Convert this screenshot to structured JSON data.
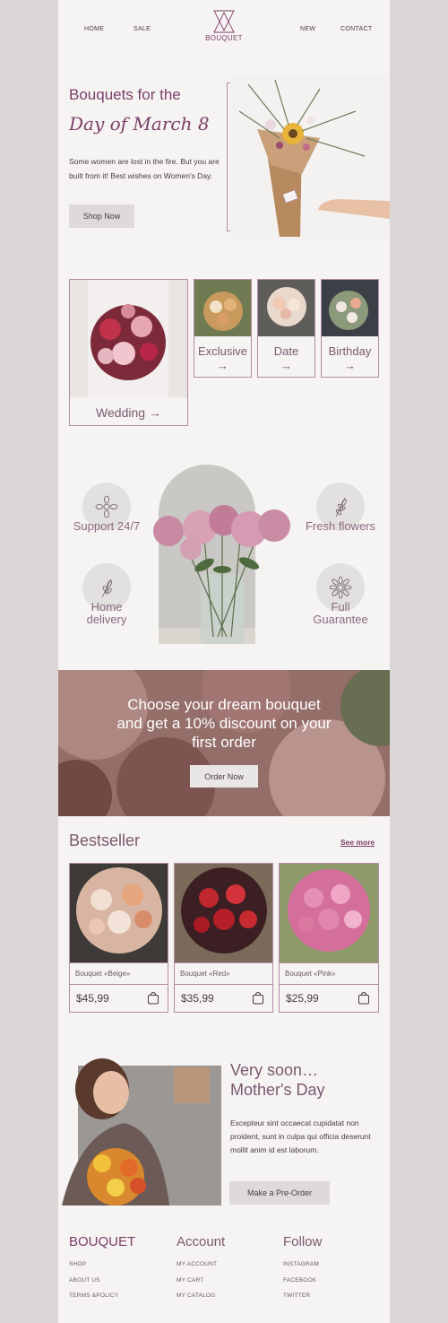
{
  "nav": {
    "home": "HOME",
    "sale": "SALE",
    "logo": "BOUQUET",
    "new": "NEW",
    "contact": "CONTACT"
  },
  "hero": {
    "title_line1": "Bouquets for the",
    "title_line2": "Day of March 8",
    "text": "Some women are lost in the fire. But you are built from it! Best wishes on Women's Day.",
    "button": "Shop Now"
  },
  "categories": [
    {
      "label": "Wedding →"
    },
    {
      "label": "Exclusive",
      "arrow": "→"
    },
    {
      "label": "Date",
      "arrow": "→"
    },
    {
      "label": "Birthday",
      "arrow": "→"
    }
  ],
  "features": [
    {
      "label": "Support 24/7",
      "icon": "flower-icon"
    },
    {
      "label": "Home delivery",
      "icon": "branch-icon"
    },
    {
      "label": "Fresh flowers",
      "icon": "sprig-icon"
    },
    {
      "label": "Full Guarantee",
      "icon": "daisy-icon"
    }
  ],
  "promo": {
    "text_line1": "Choose your dream bouquet",
    "text_line2": "and get a 10% discount on your",
    "text_line3": "first order",
    "button": "Order Now"
  },
  "bestseller": {
    "title": "Bestseller",
    "see_more": "See more",
    "products": [
      {
        "name": "Bouquet «Beige»",
        "price": "$45,99",
        "icon": "bag-icon"
      },
      {
        "name": "Bouquet «Red»",
        "price": "$35,99",
        "icon": "bag-icon"
      },
      {
        "name": "Bouquet «Pink»",
        "price": "$25,99",
        "icon": "bag-icon"
      }
    ]
  },
  "mothers": {
    "title_line1": "Very soon…",
    "title_line2": "Mother's Day",
    "text": "Excepteur sint occaecat cupidatat non proident, sunt in culpa qui officia deserunt mollit anim id est laborum.",
    "button": "Make a Pre-Order"
  },
  "footer": {
    "brand": "BOUQUET",
    "brand_links": [
      "SHOP",
      "ABOUT US",
      "TERMS &POLICY"
    ],
    "account": "Account",
    "account_links": [
      "MY ACCOUNT",
      "MY CART",
      "MY CATALOG"
    ],
    "follow": "Follow",
    "follow_links": [
      "INSTAGRAM",
      "FACEBOOK",
      "TWITTER"
    ]
  },
  "colors": {
    "accent": "#7a3f66",
    "border": "#b58aa6",
    "background": "#f6f3f3",
    "outer": "#dcd7d7"
  }
}
